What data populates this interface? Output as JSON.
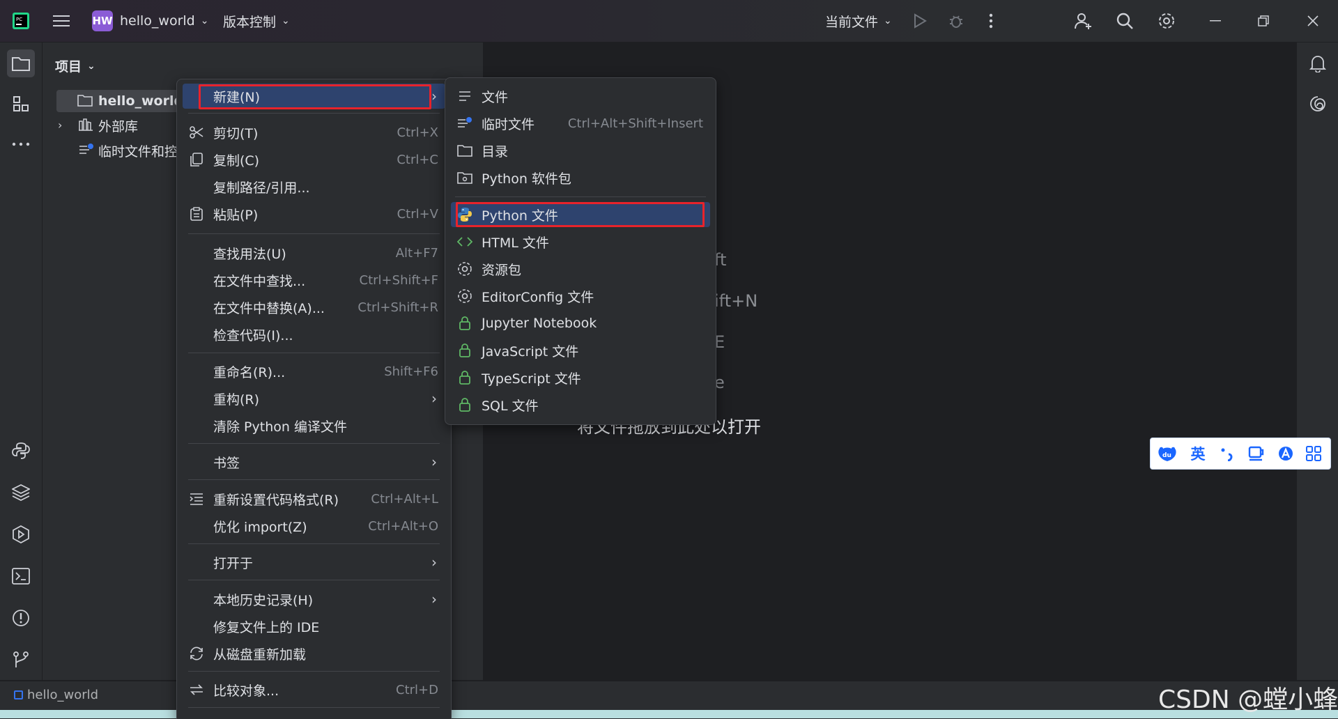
{
  "titlebar": {
    "project_badge": "HW",
    "project_name": "hello_world",
    "vcs_label": "版本控制",
    "run_config": "当前文件"
  },
  "project_panel": {
    "title": "项目",
    "tree": [
      {
        "label": "hello_world",
        "icon": "folder-icon"
      },
      {
        "label": "外部库",
        "icon": "library-icon"
      },
      {
        "label": "临时文件和控制台",
        "icon": "scratch-icon"
      }
    ]
  },
  "editor_hints": {
    "partial_1": "ft",
    "partial_2": "ift+N",
    "partial_3": "E",
    "partial_4": "e",
    "drop_hint": "将文件拖放到此处以打开"
  },
  "context_menu": {
    "items": [
      {
        "label": "新建(N)",
        "icon": "",
        "shortcut": "",
        "submenu": true,
        "selected": true
      },
      {
        "label": "剪切(T)",
        "icon": "scissors-icon",
        "shortcut": "Ctrl+X"
      },
      {
        "label": "复制(C)",
        "icon": "copy-icon",
        "shortcut": "Ctrl+C"
      },
      {
        "label": "复制路径/引用...",
        "icon": "",
        "shortcut": ""
      },
      {
        "label": "粘贴(P)",
        "icon": "paste-icon",
        "shortcut": "Ctrl+V"
      },
      {
        "label": "查找用法(U)",
        "icon": "",
        "shortcut": "Alt+F7"
      },
      {
        "label": "在文件中查找...",
        "icon": "",
        "shortcut": "Ctrl+Shift+F"
      },
      {
        "label": "在文件中替换(A)...",
        "icon": "",
        "shortcut": "Ctrl+Shift+R"
      },
      {
        "label": "检查代码(I)...",
        "icon": "",
        "shortcut": ""
      },
      {
        "label": "重命名(R)...",
        "icon": "",
        "shortcut": "Shift+F6"
      },
      {
        "label": "重构(R)",
        "icon": "",
        "shortcut": "",
        "submenu": true
      },
      {
        "label": "清除 Python 编译文件",
        "icon": "",
        "shortcut": ""
      },
      {
        "label": "书签",
        "icon": "",
        "shortcut": "",
        "submenu": true
      },
      {
        "label": "重新设置代码格式(R)",
        "icon": "format-icon",
        "shortcut": "Ctrl+Alt+L"
      },
      {
        "label": "优化 import(Z)",
        "icon": "",
        "shortcut": "Ctrl+Alt+O"
      },
      {
        "label": "打开于",
        "icon": "",
        "shortcut": "",
        "submenu": true
      },
      {
        "label": "本地历史记录(H)",
        "icon": "",
        "shortcut": "",
        "submenu": true
      },
      {
        "label": "修复文件上的 IDE",
        "icon": "",
        "shortcut": ""
      },
      {
        "label": "从磁盘重新加载",
        "icon": "reload-icon",
        "shortcut": ""
      },
      {
        "label": "比较对象...",
        "icon": "compare-icon",
        "shortcut": "Ctrl+D"
      }
    ]
  },
  "new_submenu": {
    "items": [
      {
        "label": "文件",
        "icon": "file-icon",
        "shortcut": ""
      },
      {
        "label": "临时文件",
        "icon": "scratch-file-icon",
        "shortcut": "Ctrl+Alt+Shift+Insert"
      },
      {
        "label": "目录",
        "icon": "folder-icon",
        "shortcut": ""
      },
      {
        "label": "Python 软件包",
        "icon": "package-icon",
        "shortcut": ""
      },
      {
        "label": "Python 文件",
        "icon": "python-icon",
        "shortcut": "",
        "selected": true
      },
      {
        "label": "HTML 文件",
        "icon": "html-icon",
        "shortcut": ""
      },
      {
        "label": "资源包",
        "icon": "resource-bundle-icon",
        "shortcut": ""
      },
      {
        "label": "EditorConfig 文件",
        "icon": "gear-icon",
        "shortcut": ""
      },
      {
        "label": "Jupyter Notebook",
        "icon": "lock-icon",
        "shortcut": ""
      },
      {
        "label": "JavaScript 文件",
        "icon": "lock-icon",
        "shortcut": ""
      },
      {
        "label": "TypeScript 文件",
        "icon": "lock-icon",
        "shortcut": ""
      },
      {
        "label": "SQL 文件",
        "icon": "lock-icon",
        "shortcut": ""
      }
    ]
  },
  "statusbar": {
    "breadcrumb": "hello_world"
  },
  "ime_toolbar": {
    "lang": "英"
  },
  "watermark": "CSDN @螳小蜂",
  "colors": {
    "accent_selection": "#2e436e",
    "highlight_box": "#e8232b",
    "lock_green": "#5fb865",
    "badge_purple": "#8b5cd6"
  }
}
